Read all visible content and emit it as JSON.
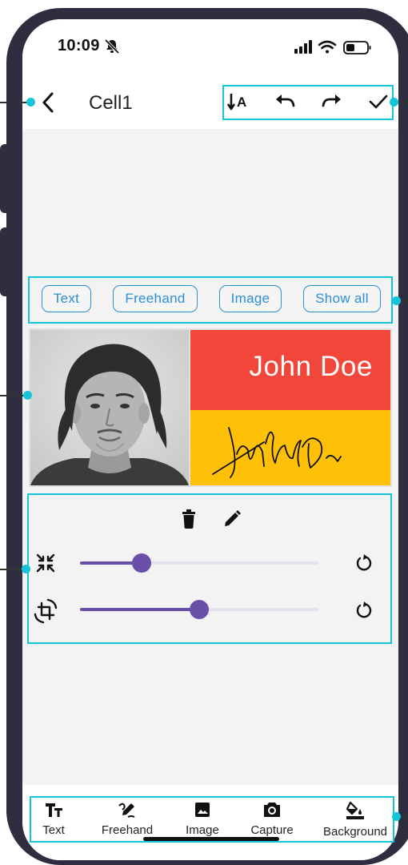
{
  "status_bar": {
    "time": "10:09"
  },
  "header": {
    "title": "Cell1"
  },
  "tabs": [
    {
      "label": "Text"
    },
    {
      "label": "Freehand"
    },
    {
      "label": "Image"
    },
    {
      "label": "Show all"
    }
  ],
  "card": {
    "name": "John Doe"
  },
  "controls": {
    "scale_slider_value": 0.26,
    "rotate_slider_value": 0.5
  },
  "bottom_nav": [
    {
      "label": "Text",
      "icon": "text-format-icon"
    },
    {
      "label": "Freehand",
      "icon": "draw-icon"
    },
    {
      "label": "Image",
      "icon": "image-icon"
    },
    {
      "label": "Capture",
      "icon": "camera-icon"
    },
    {
      "label": "Background",
      "icon": "paint-bucket-icon"
    }
  ],
  "colors": {
    "accent": "#2a8fd3",
    "slider": "#6a4fa8",
    "name_background": "#f2463a",
    "signature_background": "#ffc107",
    "annotation": "#14c4da"
  }
}
